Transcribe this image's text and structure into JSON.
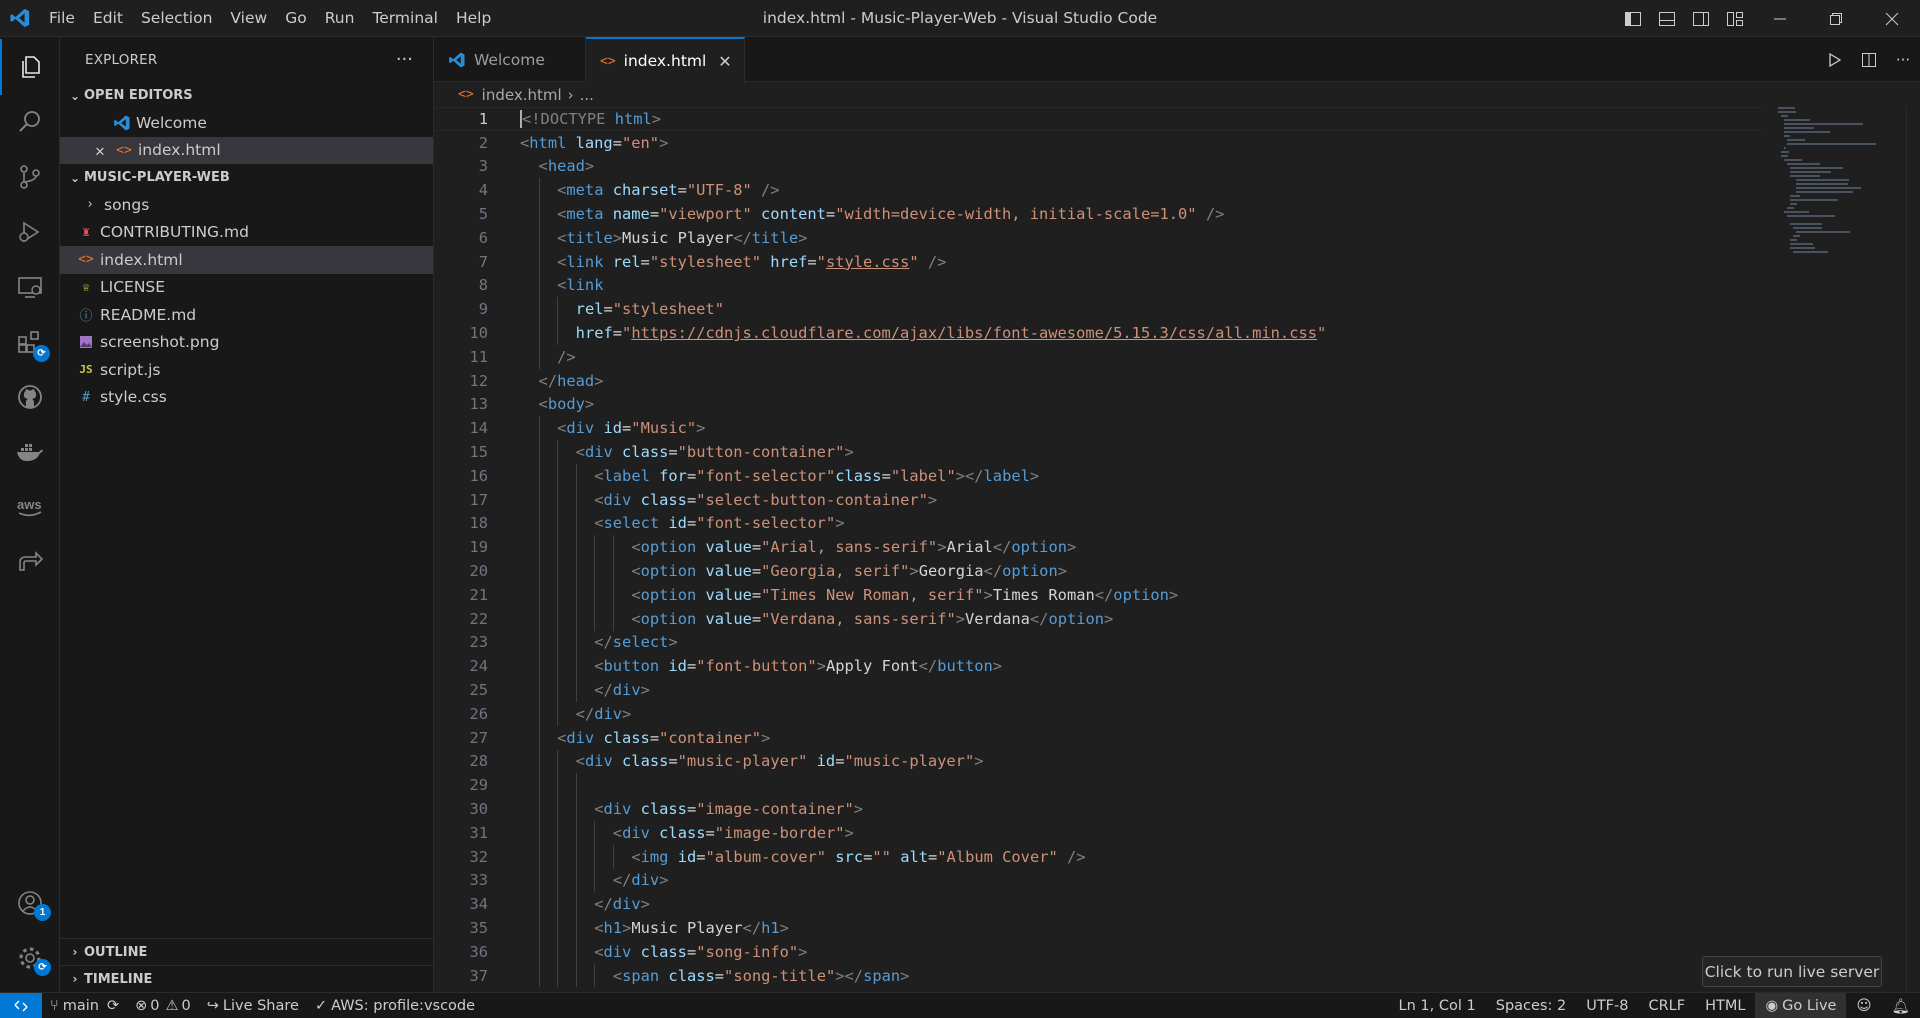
{
  "window": {
    "title": "index.html - Music-Player-Web - Visual Studio Code",
    "menu": [
      "File",
      "Edit",
      "Selection",
      "View",
      "Go",
      "Run",
      "Terminal",
      "Help"
    ]
  },
  "activity_bar": {
    "items": [
      "explorer-icon",
      "search-icon",
      "source-control-icon",
      "run-debug-icon",
      "remote-explorer-icon",
      "extensions-icon",
      "github-icon",
      "docker-icon",
      "aws-icon",
      "live-share-icon"
    ],
    "accounts_badge": "1"
  },
  "sidebar": {
    "title": "EXPLORER",
    "more": "···",
    "open_editors": {
      "label": "OPEN EDITORS",
      "items": [
        {
          "name": "Welcome",
          "icon": "vscode-icon"
        },
        {
          "name": "index.html",
          "icon": "html-icon"
        }
      ]
    },
    "folder": {
      "label": "MUSIC-PLAYER-WEB",
      "items": [
        {
          "name": "songs",
          "icon": "folder-chevron",
          "color": "#cccccc"
        },
        {
          "name": "CONTRIBUTING.md",
          "icon": "contributing-icon",
          "color": "#e05252"
        },
        {
          "name": "index.html",
          "icon": "html-icon",
          "color": "#e37933"
        },
        {
          "name": "LICENSE",
          "icon": "license-icon",
          "color": "#cbcb41"
        },
        {
          "name": "README.md",
          "icon": "info-icon",
          "color": "#519aba"
        },
        {
          "name": "screenshot.png",
          "icon": "image-icon",
          "color": "#a074c4"
        },
        {
          "name": "script.js",
          "icon": "js-icon",
          "color": "#cbcb41"
        },
        {
          "name": "style.css",
          "icon": "css-icon",
          "color": "#519aba"
        }
      ]
    },
    "outline": "OUTLINE",
    "timeline": "TIMELINE"
  },
  "editor": {
    "tabs": [
      {
        "label": "Welcome",
        "active": false
      },
      {
        "label": "index.html",
        "active": true
      }
    ],
    "breadcrumb": [
      "index.html",
      "..."
    ],
    "current_line": 1
  },
  "code_lines": [
    {
      "n": "1",
      "indent": 0,
      "parts": [
        [
          "tg",
          "<"
        ],
        [
          "tg",
          "!DOCTYPE "
        ],
        [
          "tn",
          "html"
        ],
        [
          "tg",
          ">"
        ]
      ]
    },
    {
      "n": "2",
      "indent": 0,
      "parts": [
        [
          "tg",
          "<"
        ],
        [
          "tn",
          "html "
        ],
        [
          "at",
          "lang"
        ],
        [
          "pt",
          "="
        ],
        [
          "sv",
          "\"en\""
        ],
        [
          "tg",
          ">"
        ]
      ]
    },
    {
      "n": "3",
      "indent": 1,
      "parts": [
        [
          "tg",
          "<"
        ],
        [
          "tn",
          "head"
        ],
        [
          "tg",
          ">"
        ]
      ]
    },
    {
      "n": "4",
      "indent": 2,
      "parts": [
        [
          "tg",
          "<"
        ],
        [
          "tn",
          "meta "
        ],
        [
          "at",
          "charset"
        ],
        [
          "pt",
          "="
        ],
        [
          "sv",
          "\"UTF-8\""
        ],
        [
          "tg",
          " />"
        ]
      ]
    },
    {
      "n": "5",
      "indent": 2,
      "parts": [
        [
          "tg",
          "<"
        ],
        [
          "tn",
          "meta "
        ],
        [
          "at",
          "name"
        ],
        [
          "pt",
          "="
        ],
        [
          "sv",
          "\"viewport\""
        ],
        [
          "at",
          " content"
        ],
        [
          "pt",
          "="
        ],
        [
          "sv",
          "\"width=device-width, initial-scale=1.0\""
        ],
        [
          "tg",
          " />"
        ]
      ]
    },
    {
      "n": "6",
      "indent": 2,
      "parts": [
        [
          "tg",
          "<"
        ],
        [
          "tn",
          "title"
        ],
        [
          "tg",
          ">"
        ],
        [
          "pt",
          "Music Player"
        ],
        [
          "tg",
          "</"
        ],
        [
          "tn",
          "title"
        ],
        [
          "tg",
          ">"
        ]
      ]
    },
    {
      "n": "7",
      "indent": 2,
      "parts": [
        [
          "tg",
          "<"
        ],
        [
          "tn",
          "link "
        ],
        [
          "at",
          "rel"
        ],
        [
          "pt",
          "="
        ],
        [
          "sv",
          "\"stylesheet\""
        ],
        [
          "at",
          " href"
        ],
        [
          "pt",
          "="
        ],
        [
          "sv",
          "\""
        ],
        [
          "svu",
          "style.css"
        ],
        [
          "sv",
          "\""
        ],
        [
          "tg",
          " />"
        ]
      ]
    },
    {
      "n": "8",
      "indent": 2,
      "parts": [
        [
          "tg",
          "<"
        ],
        [
          "tn",
          "link"
        ]
      ]
    },
    {
      "n": "9",
      "indent": 3,
      "parts": [
        [
          "at",
          "rel"
        ],
        [
          "pt",
          "="
        ],
        [
          "sv",
          "\"stylesheet\""
        ]
      ]
    },
    {
      "n": "10",
      "indent": 3,
      "parts": [
        [
          "at",
          "href"
        ],
        [
          "pt",
          "="
        ],
        [
          "sv",
          "\""
        ],
        [
          "svu",
          "https://cdnjs.cloudflare.com/ajax/libs/font-awesome/5.15.3/css/all.min.css"
        ],
        [
          "sv",
          "\""
        ]
      ]
    },
    {
      "n": "11",
      "indent": 2,
      "parts": [
        [
          "tg",
          "/>"
        ]
      ]
    },
    {
      "n": "12",
      "indent": 1,
      "parts": [
        [
          "tg",
          "</"
        ],
        [
          "tn",
          "head"
        ],
        [
          "tg",
          ">"
        ]
      ]
    },
    {
      "n": "13",
      "indent": 1,
      "parts": [
        [
          "tg",
          "<"
        ],
        [
          "tn",
          "body"
        ],
        [
          "tg",
          ">"
        ]
      ]
    },
    {
      "n": "14",
      "indent": 2,
      "parts": [
        [
          "tg",
          "<"
        ],
        [
          "tn",
          "div "
        ],
        [
          "at",
          "id"
        ],
        [
          "pt",
          "="
        ],
        [
          "sv",
          "\"Music\""
        ],
        [
          "tg",
          ">"
        ]
      ]
    },
    {
      "n": "15",
      "indent": 3,
      "parts": [
        [
          "tg",
          "<"
        ],
        [
          "tn",
          "div "
        ],
        [
          "at",
          "class"
        ],
        [
          "pt",
          "="
        ],
        [
          "sv",
          "\"button-container\""
        ],
        [
          "tg",
          ">"
        ]
      ]
    },
    {
      "n": "16",
      "indent": 4,
      "parts": [
        [
          "tg",
          "<"
        ],
        [
          "tn",
          "label "
        ],
        [
          "at",
          "for"
        ],
        [
          "pt",
          "="
        ],
        [
          "sv",
          "\"font-selector\""
        ],
        [
          "at",
          "class"
        ],
        [
          "pt",
          "="
        ],
        [
          "sv",
          "\"label\""
        ],
        [
          "tg",
          "></"
        ],
        [
          "tn",
          "label"
        ],
        [
          "tg",
          ">"
        ]
      ]
    },
    {
      "n": "17",
      "indent": 4,
      "parts": [
        [
          "tg",
          "<"
        ],
        [
          "tn",
          "div "
        ],
        [
          "at",
          "class"
        ],
        [
          "pt",
          "="
        ],
        [
          "sv",
          "\"select-button-container\""
        ],
        [
          "tg",
          ">"
        ]
      ]
    },
    {
      "n": "18",
      "indent": 4,
      "parts": [
        [
          "tg",
          "<"
        ],
        [
          "tn",
          "select "
        ],
        [
          "at",
          "id"
        ],
        [
          "pt",
          "="
        ],
        [
          "sv",
          "\"font-selector\""
        ],
        [
          "tg",
          ">"
        ]
      ]
    },
    {
      "n": "19",
      "indent": 6,
      "parts": [
        [
          "tg",
          "<"
        ],
        [
          "tn",
          "option "
        ],
        [
          "at",
          "value"
        ],
        [
          "pt",
          "="
        ],
        [
          "sv",
          "\"Arial, sans-serif\""
        ],
        [
          "tg",
          ">"
        ],
        [
          "pt",
          "Arial"
        ],
        [
          "tg",
          "</"
        ],
        [
          "tn",
          "option"
        ],
        [
          "tg",
          ">"
        ]
      ]
    },
    {
      "n": "20",
      "indent": 6,
      "parts": [
        [
          "tg",
          "<"
        ],
        [
          "tn",
          "option "
        ],
        [
          "at",
          "value"
        ],
        [
          "pt",
          "="
        ],
        [
          "sv",
          "\"Georgia, serif\""
        ],
        [
          "tg",
          ">"
        ],
        [
          "pt",
          "Georgia"
        ],
        [
          "tg",
          "</"
        ],
        [
          "tn",
          "option"
        ],
        [
          "tg",
          ">"
        ]
      ]
    },
    {
      "n": "21",
      "indent": 6,
      "parts": [
        [
          "tg",
          "<"
        ],
        [
          "tn",
          "option "
        ],
        [
          "at",
          "value"
        ],
        [
          "pt",
          "="
        ],
        [
          "sv",
          "\"Times New Roman, serif\""
        ],
        [
          "tg",
          ">"
        ],
        [
          "pt",
          "Times Roman"
        ],
        [
          "tg",
          "</"
        ],
        [
          "tn",
          "option"
        ],
        [
          "tg",
          ">"
        ]
      ]
    },
    {
      "n": "22",
      "indent": 6,
      "parts": [
        [
          "tg",
          "<"
        ],
        [
          "tn",
          "option "
        ],
        [
          "at",
          "value"
        ],
        [
          "pt",
          "="
        ],
        [
          "sv",
          "\"Verdana, sans-serif\""
        ],
        [
          "tg",
          ">"
        ],
        [
          "pt",
          "Verdana"
        ],
        [
          "tg",
          "</"
        ],
        [
          "tn",
          "option"
        ],
        [
          "tg",
          ">"
        ]
      ]
    },
    {
      "n": "23",
      "indent": 4,
      "parts": [
        [
          "tg",
          "</"
        ],
        [
          "tn",
          "select"
        ],
        [
          "tg",
          ">"
        ]
      ]
    },
    {
      "n": "24",
      "indent": 4,
      "parts": [
        [
          "tg",
          "<"
        ],
        [
          "tn",
          "button "
        ],
        [
          "at",
          "id"
        ],
        [
          "pt",
          "="
        ],
        [
          "sv",
          "\"font-button\""
        ],
        [
          "tg",
          ">"
        ],
        [
          "pt",
          "Apply Font"
        ],
        [
          "tg",
          "</"
        ],
        [
          "tn",
          "button"
        ],
        [
          "tg",
          ">"
        ]
      ]
    },
    {
      "n": "25",
      "indent": 4,
      "parts": [
        [
          "tg",
          "</"
        ],
        [
          "tn",
          "div"
        ],
        [
          "tg",
          ">"
        ]
      ]
    },
    {
      "n": "26",
      "indent": 3,
      "parts": [
        [
          "tg",
          "</"
        ],
        [
          "tn",
          "div"
        ],
        [
          "tg",
          ">"
        ]
      ]
    },
    {
      "n": "27",
      "indent": 2,
      "parts": [
        [
          "tg",
          "<"
        ],
        [
          "tn",
          "div "
        ],
        [
          "at",
          "class"
        ],
        [
          "pt",
          "="
        ],
        [
          "sv",
          "\"container\""
        ],
        [
          "tg",
          ">"
        ]
      ]
    },
    {
      "n": "28",
      "indent": 3,
      "parts": [
        [
          "tg",
          "<"
        ],
        [
          "tn",
          "div "
        ],
        [
          "at",
          "class"
        ],
        [
          "pt",
          "="
        ],
        [
          "sv",
          "\"music-player\""
        ],
        [
          "at",
          " id"
        ],
        [
          "pt",
          "="
        ],
        [
          "sv",
          "\"music-player\""
        ],
        [
          "tg",
          ">"
        ]
      ]
    },
    {
      "n": "29",
      "indent": 4,
      "parts": []
    },
    {
      "n": "30",
      "indent": 4,
      "parts": [
        [
          "tg",
          "<"
        ],
        [
          "tn",
          "div "
        ],
        [
          "at",
          "class"
        ],
        [
          "pt",
          "="
        ],
        [
          "sv",
          "\"image-container\""
        ],
        [
          "tg",
          ">"
        ]
      ]
    },
    {
      "n": "31",
      "indent": 5,
      "parts": [
        [
          "tg",
          "<"
        ],
        [
          "tn",
          "div "
        ],
        [
          "at",
          "class"
        ],
        [
          "pt",
          "="
        ],
        [
          "sv",
          "\"image-border\""
        ],
        [
          "tg",
          ">"
        ]
      ]
    },
    {
      "n": "32",
      "indent": 6,
      "parts": [
        [
          "tg",
          "<"
        ],
        [
          "tn",
          "img "
        ],
        [
          "at",
          "id"
        ],
        [
          "pt",
          "="
        ],
        [
          "sv",
          "\"album-cover\""
        ],
        [
          "at",
          " src"
        ],
        [
          "pt",
          "="
        ],
        [
          "sv",
          "\"\""
        ],
        [
          "at",
          " alt"
        ],
        [
          "pt",
          "="
        ],
        [
          "sv",
          "\"Album Cover\""
        ],
        [
          "tg",
          " />"
        ]
      ]
    },
    {
      "n": "33",
      "indent": 5,
      "parts": [
        [
          "tg",
          "</"
        ],
        [
          "tn",
          "div"
        ],
        [
          "tg",
          ">"
        ]
      ]
    },
    {
      "n": "34",
      "indent": 4,
      "parts": [
        [
          "tg",
          "</"
        ],
        [
          "tn",
          "div"
        ],
        [
          "tg",
          ">"
        ]
      ]
    },
    {
      "n": "35",
      "indent": 4,
      "parts": [
        [
          "tg",
          "<"
        ],
        [
          "tn",
          "h1"
        ],
        [
          "tg",
          ">"
        ],
        [
          "pt",
          "Music Player"
        ],
        [
          "tg",
          "</"
        ],
        [
          "tn",
          "h1"
        ],
        [
          "tg",
          ">"
        ]
      ]
    },
    {
      "n": "36",
      "indent": 4,
      "parts": [
        [
          "tg",
          "<"
        ],
        [
          "tn",
          "div "
        ],
        [
          "at",
          "class"
        ],
        [
          "pt",
          "="
        ],
        [
          "sv",
          "\"song-info\""
        ],
        [
          "tg",
          ">"
        ]
      ]
    },
    {
      "n": "37",
      "indent": 5,
      "parts": [
        [
          "tg",
          "<"
        ],
        [
          "tn",
          "span "
        ],
        [
          "at",
          "class"
        ],
        [
          "pt",
          "="
        ],
        [
          "sv",
          "\"song-title\""
        ],
        [
          "tg",
          "></"
        ],
        [
          "tn",
          "span"
        ],
        [
          "tg",
          ">"
        ]
      ]
    }
  ],
  "status_bar": {
    "branch": "main",
    "errors": "0",
    "warnings": "0",
    "live_share": "Live Share",
    "aws": "AWS: profile:vscode",
    "position": "Ln 1, Col 1",
    "spaces": "Spaces: 2",
    "encoding": "UTF-8",
    "eol": "CRLF",
    "language": "HTML",
    "go_live": "Go Live"
  },
  "tooltip": "Click to run live server",
  "colors": {
    "accent": "#0078d4",
    "html_icon": "#e37933",
    "tag": "#569cd6",
    "attribute": "#9cdcfe",
    "string": "#ce9178"
  }
}
